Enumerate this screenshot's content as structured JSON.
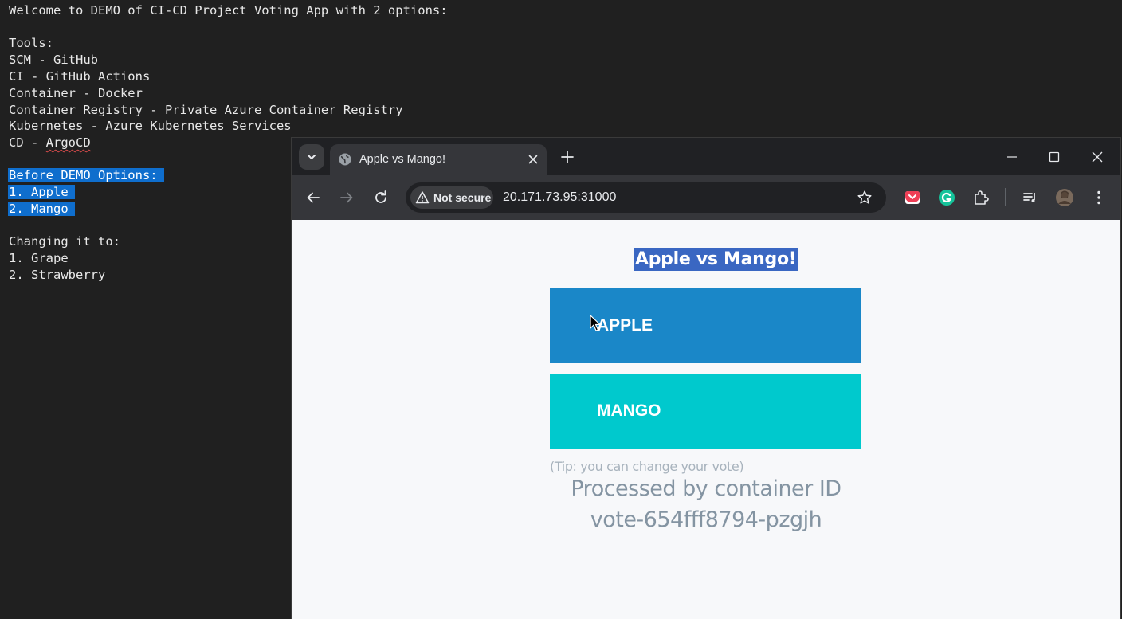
{
  "editor": {
    "lines": [
      "Welcome to DEMO of CI-CD Project Voting App with 2 options:",
      "",
      "Tools:",
      "SCM - GitHub",
      "CI - GitHub Actions",
      "Container - Docker",
      "Container Registry - Private Azure Container Registry",
      "Kubernetes - Azure Kubernetes Services",
      "CD - ArgoCD",
      "",
      "Before DEMO Options:",
      "1. Apple",
      "2. Mango",
      "",
      "Changing it to:",
      "1. Grape",
      "2. Strawberry"
    ],
    "cd_prefix": "CD - ",
    "cd_word": "ArgoCD"
  },
  "browser": {
    "tab_title": "Apple vs Mango!",
    "security_label": "Not secure",
    "url": "20.171.73.95:31000"
  },
  "page": {
    "heading": "Apple vs Mango!",
    "option_a": "APPLE",
    "option_b": "MANGO",
    "tip": "(Tip: you can change your vote)",
    "processed_line1": "Processed by container ID",
    "processed_line2": "vote-654fff8794-pzgjh"
  },
  "colors": {
    "option_a": "#1a87c8",
    "option_b": "#00c9cd",
    "selection": "#0f6ecd",
    "heading_highlight": "#3a67c2"
  },
  "icons": [
    "tab-list-icon",
    "globe-icon",
    "close-tab-icon",
    "new-tab-icon",
    "minimize-icon",
    "maximize-icon",
    "close-window-icon",
    "back-icon",
    "forward-icon",
    "reload-icon",
    "warning-icon",
    "bookmark-star-icon",
    "pocket-extension-icon",
    "grammarly-extension-icon",
    "extensions-puzzle-icon",
    "media-control-icon",
    "profile-avatar-icon",
    "menu-dots-icon",
    "mouse-cursor-icon"
  ]
}
